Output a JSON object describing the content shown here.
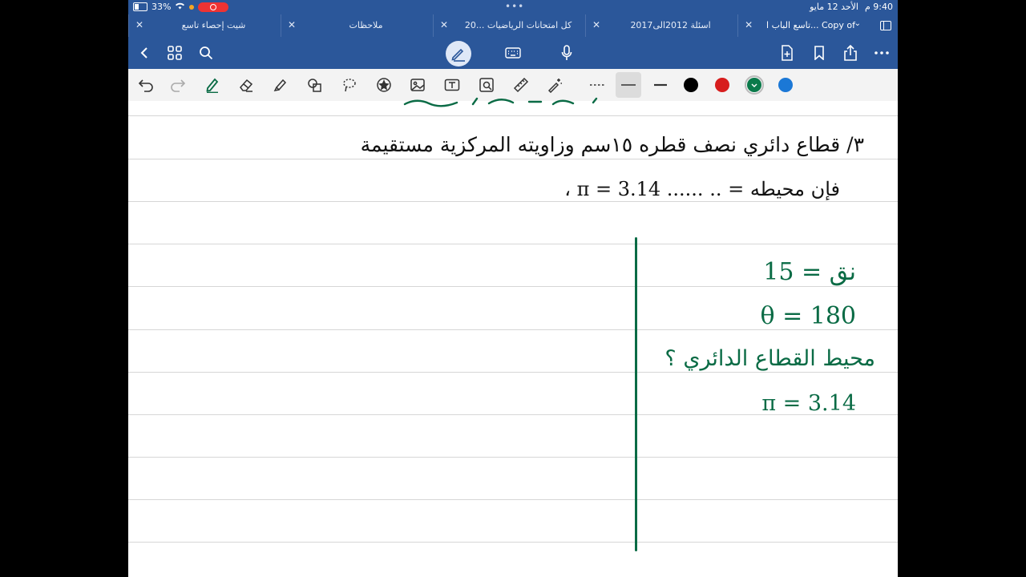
{
  "status": {
    "battery": "33%",
    "time": "9:40",
    "ampm": "م",
    "date": "الأحد 12 مايو"
  },
  "tabs": [
    {
      "label": "شيت إحصاء تاسع"
    },
    {
      "label": "ملاحظات"
    },
    {
      "label": "كل امتحانات الرياضيات ...20"
    },
    {
      "label": "اسئلة 2012الى2017"
    },
    {
      "label": "تاسع الباب ا... Copy of"
    }
  ],
  "toolbar": {
    "icons": [
      "back-icon",
      "grid-icon",
      "search-icon",
      "pen-mode-icon",
      "keyboard-icon",
      "microphone-icon",
      "new-page-icon",
      "bookmark-icon",
      "share-icon",
      "more-icon"
    ]
  },
  "colors": {
    "brand": "#2b579a",
    "ink_black": "#111111",
    "ink_green": "#0a6b45",
    "palette": [
      "#000000",
      "#d71d1d",
      "#0a7a4a",
      "#1b78d6"
    ]
  },
  "note": {
    "line1": "٣/ قطاع دائري نصف قطره ١٥سم وزاويته المركزية مستقيمة",
    "line2": "فإن محيطه = .. ...... ‎π = 3.14 ،",
    "given_r": "نق = 15",
    "given_theta": "θ = 180",
    "question": "محيط القطاع الدائري ؟",
    "given_pi": "π = 3.14"
  }
}
